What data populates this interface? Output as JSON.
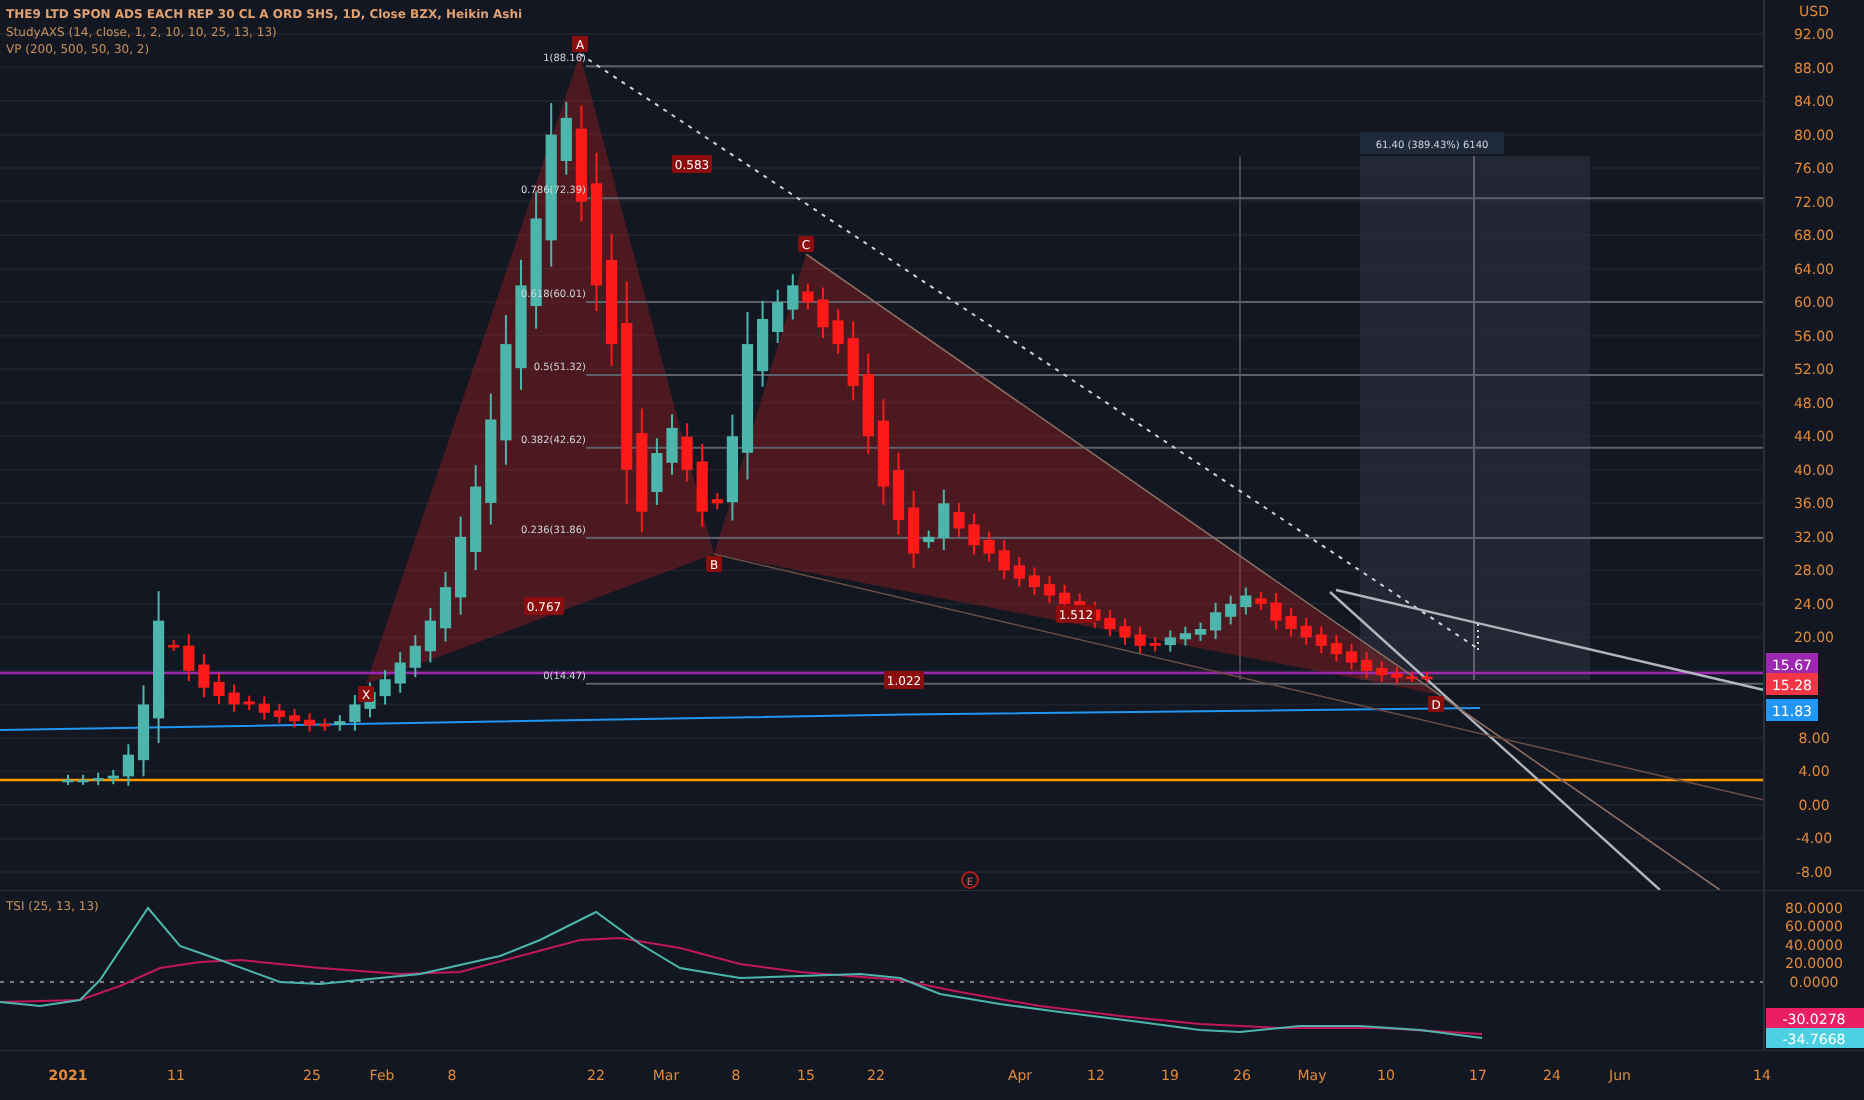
{
  "legend": {
    "title": "THE9 LTD SPON ADS EACH REP 30 CL A ORD SHS, 1D, Close BZX, Heikin Ashi",
    "indicators": [
      "StudyAXS (14, close, 1, 2, 10, 10, 25, 13, 13)",
      "VP (200, 500, 50, 30, 2)"
    ]
  },
  "price_axis": {
    "currency": "USD",
    "labels": [
      "92.00",
      "88.00",
      "84.00",
      "80.00",
      "76.00",
      "72.00",
      "68.00",
      "64.00",
      "60.00",
      "56.00",
      "52.00",
      "48.00",
      "44.00",
      "40.00",
      "36.00",
      "32.00",
      "28.00",
      "24.00",
      "20.00",
      "8.00",
      "4.00",
      "0.00",
      "-4.00",
      "-8.00"
    ]
  },
  "price_tags": [
    {
      "text": "15.67",
      "color": "#9c27b0"
    },
    {
      "text": "15.28",
      "color": "#f23645"
    },
    {
      "text": "11.83",
      "color": "#2196f3"
    }
  ],
  "pattern_points": [
    "X",
    "A",
    "B",
    "C",
    "D"
  ],
  "fib_levels": [
    "1(88.16)",
    "0.786(72.39)",
    "0.618(60.01)",
    "0.5(51.32)",
    "0.382(42.62)",
    "0.236(31.86)",
    "0(14.47)"
  ],
  "ratios": [
    "0.583",
    "0.767",
    "1.512",
    "1.022"
  ],
  "measure_label": "61.40 (389.43%) 6140",
  "event_marker": "E",
  "tsi": {
    "title": "TSI (25, 13, 13)",
    "axis_labels": [
      "80.0000",
      "60.0000",
      "40.0000",
      "20.0000",
      "0.0000"
    ],
    "tags": [
      {
        "text": "-30.0278",
        "color": "#e91e63"
      },
      {
        "text": "-34.7668",
        "color": "#4dd0e1"
      }
    ]
  },
  "time_axis": [
    "2021",
    "11",
    "25",
    "Feb",
    "8",
    "22",
    "Mar",
    "8",
    "15",
    "22",
    "Apr",
    "12",
    "19",
    "26",
    "May",
    "10",
    "17",
    "24",
    "Jun",
    "14"
  ]
}
